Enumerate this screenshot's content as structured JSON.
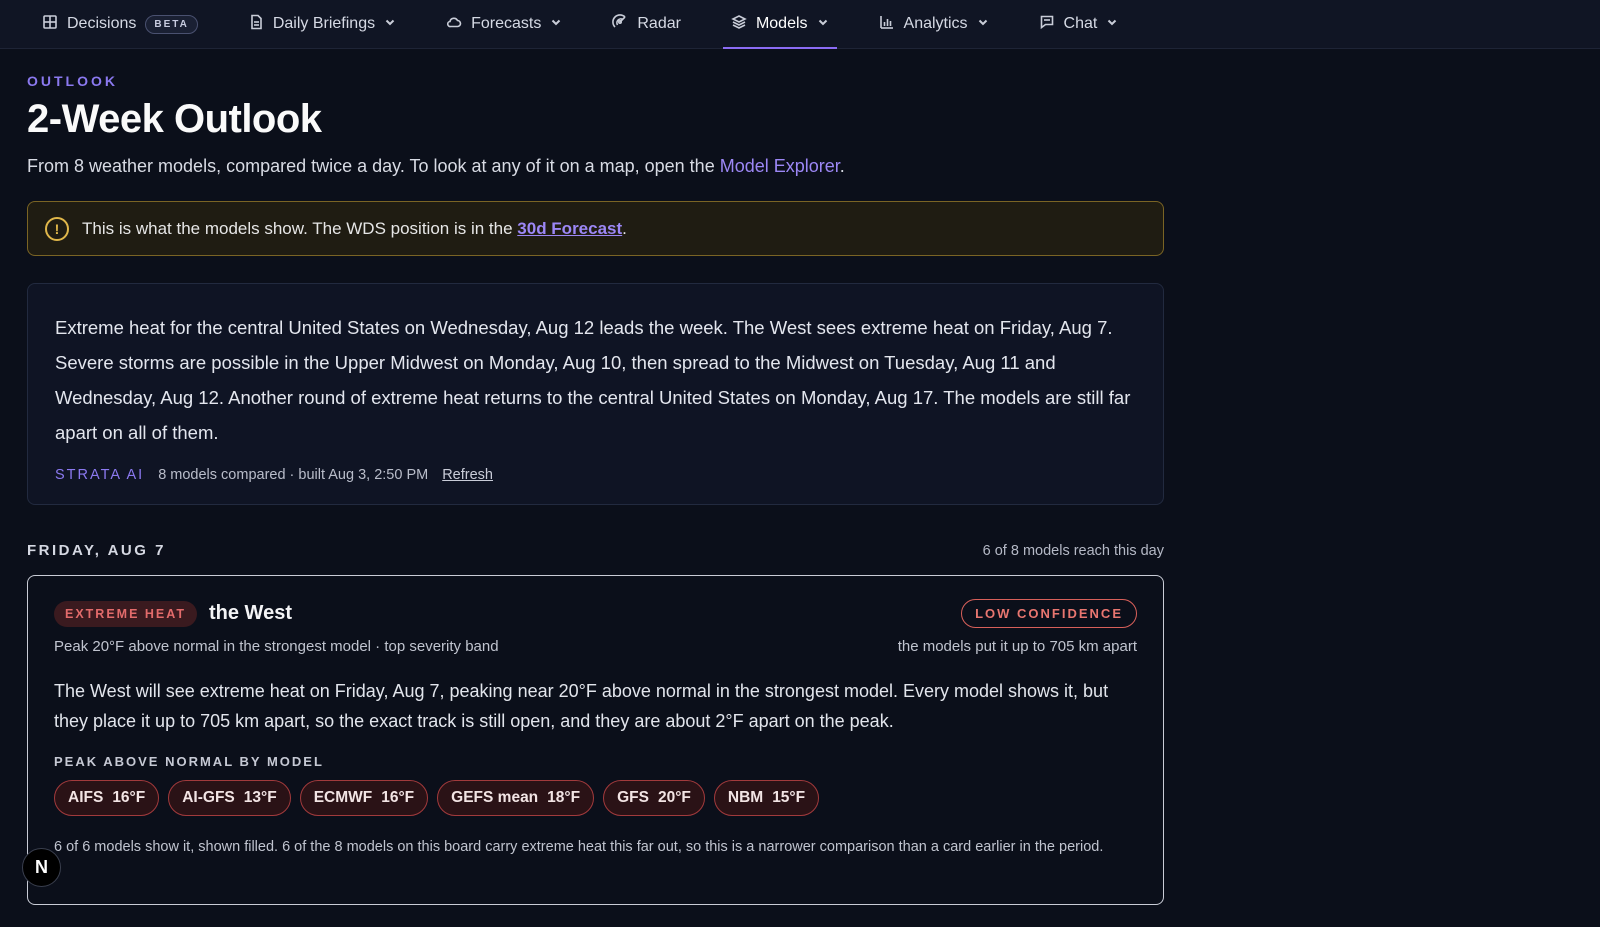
{
  "nav": {
    "decisions": "Decisions",
    "beta": "BETA",
    "daily_briefings": "Daily Briefings",
    "forecasts": "Forecasts",
    "radar": "Radar",
    "models": "Models",
    "analytics": "Analytics",
    "chat": "Chat"
  },
  "header": {
    "eyebrow": "OUTLOOK",
    "title": "2-Week Outlook",
    "intro_text": "From 8 weather models, compared twice a day. To look at any of it on a map, open the ",
    "intro_link": "Model Explorer",
    "intro_end": "."
  },
  "notice": {
    "text": "This is what the models show. The WDS position is in the ",
    "link": "30d Forecast",
    "end": "."
  },
  "summary": {
    "text": "Extreme heat for the central United States on Wednesday, Aug 12 leads the week. The West sees extreme heat on Friday, Aug 7. Severe storms are possible in the Upper Midwest on Monday, Aug 10, then spread to the Midwest on Tuesday, Aug 11 and Wednesday, Aug 12. Another round of extreme heat returns to the central United States on Monday, Aug 17. The models are still far apart on all of them.",
    "brand": "STRATA AI",
    "meta": "8 models compared · built Aug 3, 2:50 PM",
    "refresh": "Refresh"
  },
  "day": {
    "label": "FRIDAY, AUG 7",
    "reach": "6 of 8 models reach this day"
  },
  "card": {
    "tag": "EXTREME HEAT",
    "region": "the West",
    "confidence": "LOW CONFIDENCE",
    "peak": "Peak 20°F above normal in the strongest model · top severity band",
    "spread": "the models put it up to 705 km apart",
    "body": "The West will see extreme heat on Friday, Aug 7, peaking near 20°F above normal in the strongest model. Every model shows it, but they place it up to 705 km apart, so the exact track is still open, and they are about 2°F apart on the peak.",
    "by_model_label": "PEAK ABOVE NORMAL BY MODEL",
    "models": [
      {
        "name": "AIFS",
        "value": "16°F"
      },
      {
        "name": "AI-GFS",
        "value": "13°F"
      },
      {
        "name": "ECMWF",
        "value": "16°F"
      },
      {
        "name": "GEFS mean",
        "value": "18°F"
      },
      {
        "name": "GFS",
        "value": "20°F"
      },
      {
        "name": "NBM",
        "value": "15°F"
      }
    ],
    "note": "6 of 6 models show it, shown filled. 6 of the 8 models on this board carry extreme heat this far out, so this is a narrower comparison than a card earlier in the period."
  },
  "fab": {
    "letter": "N"
  },
  "colors": {
    "accent": "#8b79f0",
    "heat": "#e26b6b",
    "warning": "#e0b74a"
  }
}
